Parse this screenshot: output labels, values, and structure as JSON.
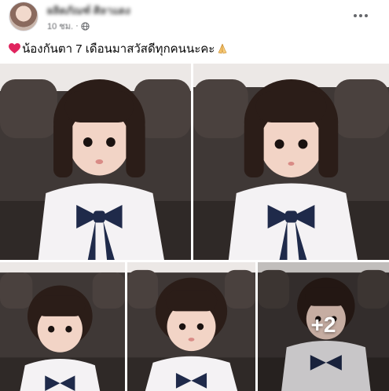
{
  "post": {
    "author_name": "ผลิตภัณฑ์ ศิลาแดง",
    "timestamp": "10 ชม.",
    "privacy_icon": "globe-icon",
    "more_icon": "more-options-icon",
    "caption_prefix_icon": "red-heart-emoji-icon",
    "caption_text": "น้องกันตา 7 เดือนมาสวัสดีทุกคนนะคะ",
    "caption_suffix_icon": "folded-hands-emoji-icon"
  },
  "photos": {
    "count_shown": 5,
    "more_count_label": "+2"
  },
  "colors": {
    "text_primary": "#050505",
    "text_secondary": "#65676b",
    "heart": "#e0245e",
    "sofa": "#3c3634",
    "bow": "#1f2a4a"
  }
}
